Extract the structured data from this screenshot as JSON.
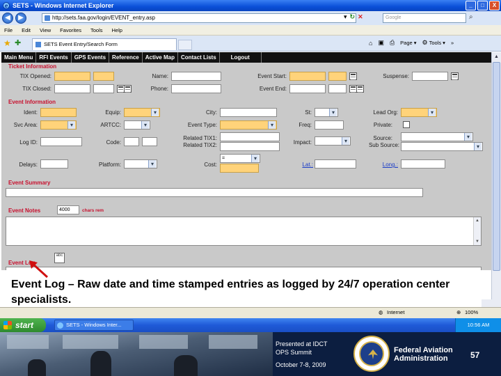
{
  "window": {
    "title": "SETS - Windows Internet Explorer",
    "minimize": "_",
    "maximize": "□",
    "close": "X"
  },
  "address": {
    "url": "http://sets.faa.gov/login/EVENT_entry.asp",
    "search_placeholder": "Google"
  },
  "menu": [
    "File",
    "Edit",
    "View",
    "Favorites",
    "Tools",
    "Help"
  ],
  "tab": {
    "title": "SETS Event Entry/Search Form"
  },
  "toolbar": {
    "page_label": "Page",
    "tools_label": "Tools"
  },
  "nav": [
    "Main Menu",
    "RFI Events",
    "GPS Events",
    "Reference",
    "Active Map",
    "Contact Lists",
    "Logout"
  ],
  "form": {
    "ticket_info_header": "Ticket Information",
    "tix_opened_label": "TIX Opened:",
    "tix_closed_label": "TIX Closed:",
    "name_label": "Name:",
    "phone_label": "Phone:",
    "event_start_label": "Event Start:",
    "event_end_label": "Event End:",
    "suspense_label": "Suspense:",
    "event_info_header": "Event Information",
    "ident_label": "Ident:",
    "equip_label": "Equip:",
    "city_label": "City:",
    "st_label": "St:",
    "lead_org_label": "Lead Org:",
    "svc_area_label": "Svc Area:",
    "artcc_label": "ARTCC:",
    "event_type_label": "Event Type:",
    "freq_label": "Freq:",
    "private_label": "Private:",
    "log_id_label": "Log ID:",
    "code_label": "Code:",
    "related_tix1_label": "Related TIX1:",
    "related_tix2_label": "Related TIX2:",
    "impact_label": "Impact:",
    "source_label": "Source:",
    "sub_source_label": "Sub Source:",
    "delays_label": "Delays:",
    "platform_label": "Platform:",
    "cost_label": "Cost:",
    "cost_currency": "=",
    "lat_label": "Lat.:",
    "long_label": "Long.:",
    "event_summary_header": "Event Summary",
    "event_notes_header": "Event Notes",
    "chars_remaining_value": "4000",
    "chars_remaining_label": "chars rem",
    "event_log_header": "Event Log",
    "spell_label": "abc"
  },
  "annotation": {
    "text": "Event Log – Raw date and time stamped entries as logged by 24/7 operation center specialists.",
    "arrow_color": "#d01010"
  },
  "status": {
    "zone": "Internet",
    "zoom": "100%"
  },
  "taskbar": {
    "start_label": "start",
    "task_label": "SETS - Windows Inter...",
    "clock": "10:56 AM"
  },
  "footer": {
    "presented_line1": "Presented at IDCT",
    "presented_line2": "OPS Summit",
    "date": "October 7-8, 2009",
    "agency_line1": "Federal Aviation",
    "agency_line2": "Administration",
    "page_number": "57"
  },
  "colors": {
    "section_header": "#c8102e",
    "required_field": "#ffd37a",
    "nav_background": "#111111",
    "form_background": "#c9c9c9",
    "footer_background": "#0c1e40"
  }
}
